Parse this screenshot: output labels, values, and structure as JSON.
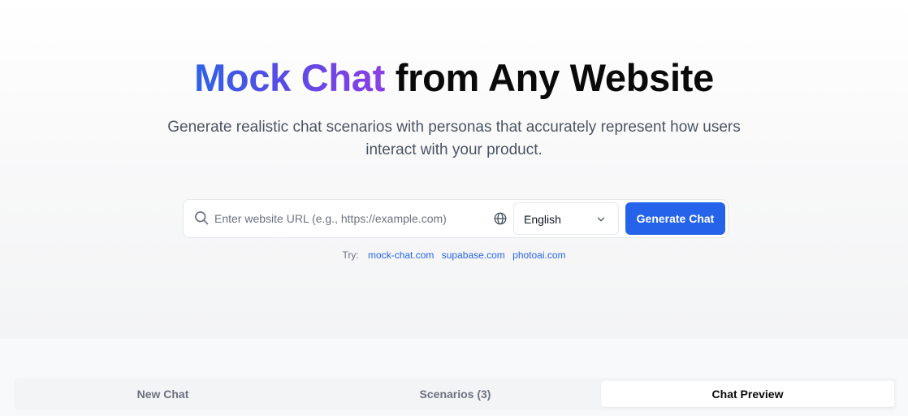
{
  "hero": {
    "title_highlight": "Mock Chat",
    "title_rest": "from Any Website",
    "subtitle": "Generate realistic chat scenarios with personas that accurately represent how users interact with your product."
  },
  "search": {
    "placeholder": "Enter website URL (e.g., https://example.com)",
    "value": "",
    "language": "English",
    "generate_label": "Generate Chat",
    "icons": {
      "search": "search-icon",
      "globe": "globe-icon",
      "chevron": "chevron-down-icon"
    }
  },
  "suggestions": {
    "label": "Try:",
    "links": [
      "mock-chat.com",
      "supabase.com",
      "photoai.com"
    ]
  },
  "tabs": [
    {
      "label": "New Chat",
      "active": false
    },
    {
      "label": "Scenarios (3)",
      "active": false
    },
    {
      "label": "Chat Preview",
      "active": true
    }
  ],
  "colors": {
    "accent": "#2563eb",
    "gradient_start": "#2e62e8",
    "gradient_end": "#8b3ee6",
    "muted_text": "#6b7280"
  }
}
